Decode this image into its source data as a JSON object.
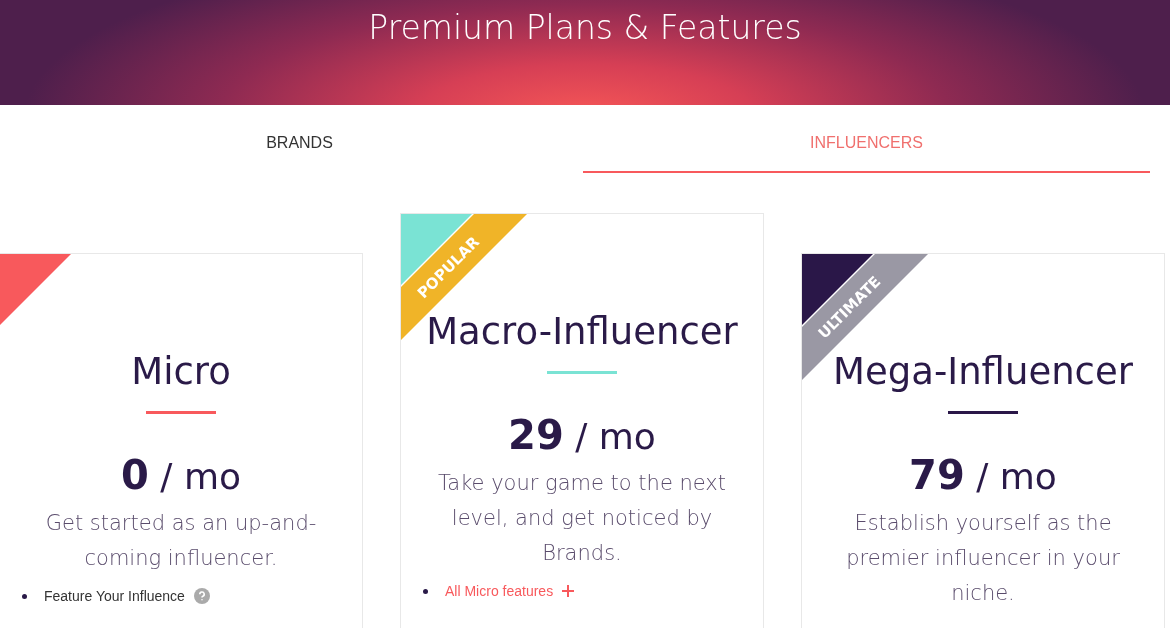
{
  "header": {
    "title": "Premium Plans & Features"
  },
  "tabs": [
    {
      "label": "BRANDS",
      "selected": false
    },
    {
      "label": "INFLUENCERS",
      "selected": true
    }
  ],
  "plans": [
    {
      "name": "Micro",
      "color": "#f8595c",
      "price": "0",
      "period": " / mo",
      "description": "Get started as an up-and-coming influencer.",
      "raised": false,
      "features": [
        {
          "kind": "info",
          "text": "Feature Your Influence"
        }
      ]
    },
    {
      "name": "Macro-Influencer",
      "color": "#7ae3d4",
      "ribbon": {
        "label": "POPULAR",
        "color": "#f0b428"
      },
      "price": "29",
      "period": " / mo",
      "description": "Take your game to the next level, and get noticed by Brands.",
      "raised": true,
      "features": [
        {
          "kind": "link",
          "text": "All Micro features"
        }
      ]
    },
    {
      "name": "Mega-Influencer",
      "color": "#2a1748",
      "ribbon": {
        "label": "ULTIMATE",
        "color": "#9a98a4"
      },
      "price": "79",
      "period": " / mo",
      "description": "Establish yourself as the premier influencer in your niche.",
      "raised": false
    }
  ]
}
